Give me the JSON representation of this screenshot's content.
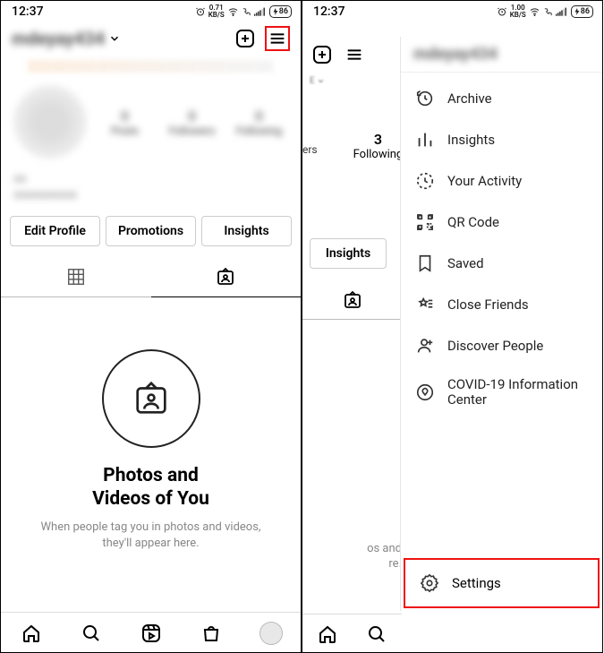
{
  "status": {
    "time": "12:37",
    "kbs_a": "0.71",
    "kbs_b": "1.00",
    "kbs_unit": "KB/S",
    "battery": "86"
  },
  "profile": {
    "username_blur": "mdeyay434",
    "buttons": {
      "edit": "Edit Profile",
      "promotions": "Promotions",
      "insights": "Insights"
    },
    "stat_following_n": "3",
    "stat_following_l": "Following",
    "partial_stat_l": "ers"
  },
  "empty": {
    "title_l1": "Photos and",
    "title_l2": "Videos of You",
    "sub": "When people tag you in photos and videos, they'll appear here.",
    "sub_partial_l1": "os and",
    "sub_partial_l2": "re."
  },
  "drawer": {
    "items": [
      {
        "icon": "archive",
        "label": "Archive"
      },
      {
        "icon": "insights",
        "label": "Insights"
      },
      {
        "icon": "activity",
        "label": "Your Activity"
      },
      {
        "icon": "qr",
        "label": "QR Code"
      },
      {
        "icon": "saved",
        "label": "Saved"
      },
      {
        "icon": "close-friends",
        "label": "Close Friends"
      },
      {
        "icon": "discover",
        "label": "Discover People"
      },
      {
        "icon": "covid",
        "label": "COVID-19 Information Center"
      }
    ],
    "settings": "Settings"
  }
}
